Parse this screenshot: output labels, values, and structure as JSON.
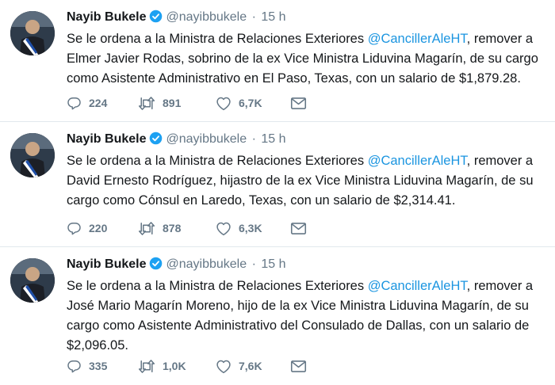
{
  "tweets": [
    {
      "name": "Nayib Bukele",
      "handle": "@nayibbukele",
      "separator": "·",
      "time": "15 h",
      "text_before": "Se le ordena a la Ministra de Relaciones Exteriores ",
      "mention": "@CancillerAleHT",
      "text_after": ", remover a Elmer Javier Rodas, sobrino de la ex Vice Ministra Liduvina Magarín, de su cargo como Asistente Administrativo en El Paso, Texas, con un salario de $1,879.28.",
      "replies": "224",
      "retweets": "891",
      "likes": "6,7K"
    },
    {
      "name": "Nayib Bukele",
      "handle": "@nayibbukele",
      "separator": "·",
      "time": "15 h",
      "text_before": "Se le ordena a la Ministra de Relaciones Exteriores ",
      "mention": "@CancillerAleHT",
      "text_after": ", remover a David Ernesto Rodríguez, hijastro de la ex Vice Ministra Liduvina Magarín, de su cargo como Cónsul en Laredo, Texas, con un salario de $2,314.41.",
      "replies": "220",
      "retweets": "878",
      "likes": "6,3K"
    },
    {
      "name": "Nayib Bukele",
      "handle": "@nayibbukele",
      "separator": "·",
      "time": "15 h",
      "text_before": "Se le ordena a la Ministra de Relaciones Exteriores ",
      "mention": "@CancillerAleHT",
      "text_after": ", remover a José Mario Magarín Moreno, hijo de la ex Vice Ministra Liduvina Magarín, de su cargo como Asistente Administrativo del Consulado de Dallas, con un salario de $2,096.05.",
      "replies": "335",
      "retweets": "1,0K",
      "likes": "7,6K"
    }
  ],
  "icons": {
    "verified": "verified-badge-icon",
    "reply": "reply-icon",
    "retweet": "retweet-icon",
    "like": "heart-icon",
    "message": "direct-message-icon"
  },
  "colors": {
    "link": "#1b95e0",
    "muted": "#657786",
    "verified": "#1da1f2",
    "divider": "#e1e8ed"
  }
}
